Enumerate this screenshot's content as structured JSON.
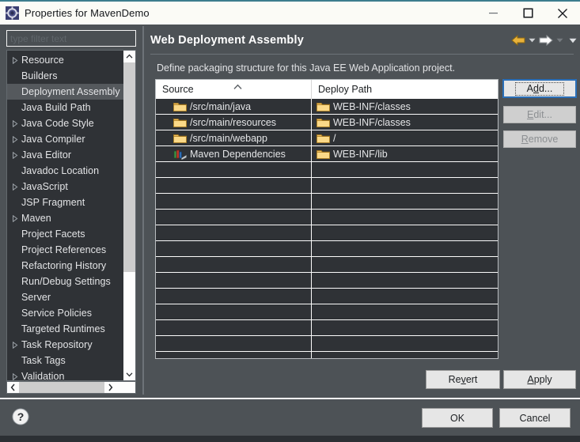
{
  "window": {
    "title": "Properties for MavenDemo",
    "icon": "properties-gear-icon",
    "minimize_label": "Minimize",
    "maximize_label": "Maximize",
    "close_label": "Close",
    "accent_color": "#3c7d8e"
  },
  "filter": {
    "placeholder": "type filter text",
    "value": ""
  },
  "sidebar": {
    "selected": "Deployment Assembly",
    "items": [
      {
        "label": "Resource",
        "expandable": true
      },
      {
        "label": "Builders",
        "expandable": false
      },
      {
        "label": "Deployment Assembly",
        "expandable": false
      },
      {
        "label": "Java Build Path",
        "expandable": false
      },
      {
        "label": "Java Code Style",
        "expandable": true
      },
      {
        "label": "Java Compiler",
        "expandable": true
      },
      {
        "label": "Java Editor",
        "expandable": true
      },
      {
        "label": "Javadoc Location",
        "expandable": false
      },
      {
        "label": "JavaScript",
        "expandable": true
      },
      {
        "label": "JSP Fragment",
        "expandable": false
      },
      {
        "label": "Maven",
        "expandable": true
      },
      {
        "label": "Project Facets",
        "expandable": false
      },
      {
        "label": "Project References",
        "expandable": false
      },
      {
        "label": "Refactoring History",
        "expandable": false
      },
      {
        "label": "Run/Debug Settings",
        "expandable": false
      },
      {
        "label": "Server",
        "expandable": false
      },
      {
        "label": "Service Policies",
        "expandable": false
      },
      {
        "label": "Targeted Runtimes",
        "expandable": false
      },
      {
        "label": "Task Repository",
        "expandable": true
      },
      {
        "label": "Task Tags",
        "expandable": false
      },
      {
        "label": "Validation",
        "expandable": true
      }
    ]
  },
  "page": {
    "title": "Web Deployment Assembly",
    "description": "Define packaging structure for this Java EE Web Application project.",
    "nav": {
      "back_icon": "back-arrow-icon",
      "back_menu_icon": "chevron-down-icon",
      "forward_icon": "forward-arrow-icon",
      "forward_menu_icon": "chevron-down-icon",
      "view_menu_icon": "chevron-down-icon"
    }
  },
  "table": {
    "columns": [
      "Source",
      "Deploy Path"
    ],
    "sort_indicator": "ascending-caret-icon",
    "sort_column": "Source",
    "rows": [
      {
        "source": "/src/main/java",
        "source_icon": "folder-icon",
        "deploy": "WEB-INF/classes",
        "deploy_icon": "folder-icon"
      },
      {
        "source": "/src/main/resources",
        "source_icon": "folder-icon",
        "deploy": "WEB-INF/classes",
        "deploy_icon": "folder-icon"
      },
      {
        "source": "/src/main/webapp",
        "source_icon": "folder-icon",
        "deploy": "/",
        "deploy_icon": "folder-icon"
      },
      {
        "source": "Maven Dependencies",
        "source_icon": "library-books-icon",
        "deploy": "WEB-INF/lib",
        "deploy_icon": "folder-icon"
      }
    ],
    "empty_row_count": 13
  },
  "side_buttons": [
    {
      "label": "Add...",
      "mnemonic": "d",
      "enabled": true,
      "focused": true
    },
    {
      "label": "Edit...",
      "mnemonic": "E",
      "enabled": false,
      "focused": false
    },
    {
      "label": "Remove",
      "mnemonic": "R",
      "enabled": false,
      "focused": false
    }
  ],
  "bottom_buttons": {
    "revert": {
      "label": "Revert",
      "mnemonic": "v"
    },
    "apply": {
      "label": "Apply",
      "mnemonic": "A"
    },
    "ok": {
      "label": "OK"
    },
    "cancel": {
      "label": "Cancel"
    }
  },
  "help": {
    "icon": "help-question-icon",
    "label": "Help"
  },
  "scrollbars": {
    "tree_vertical": {
      "up_icon": "chevron-up-icon",
      "down_icon": "chevron-down-icon"
    },
    "tree_horizontal": {
      "left_icon": "chevron-left-icon",
      "right_icon": "chevron-right-icon"
    }
  }
}
